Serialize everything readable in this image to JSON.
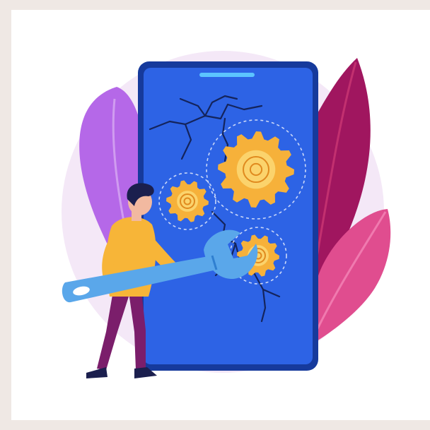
{
  "illustration": {
    "subject": "phone-repair",
    "icons": [
      "wrench-icon",
      "gear-icon",
      "smartphone-icon",
      "leaf-icon",
      "person-icon"
    ],
    "colors": {
      "background": "#efe8e4",
      "card": "#ffffff",
      "halo": "#f4e8f7",
      "phone_screen": "#2d63e5",
      "phone_body": "#163a9c",
      "gear": "#f6b13a",
      "gear_inner": "#fbd36c",
      "wrench": "#5aa7ea",
      "wrench_dark": "#2f7fd0",
      "leaf_left": "#b568e8",
      "leaf_right": "#a0165f",
      "leaf_bottom": "#e04d8f",
      "shirt": "#f7b538",
      "pants": "#7b1e6b",
      "hair": "#1b1f4e",
      "skin": "#f2b9a0"
    }
  }
}
